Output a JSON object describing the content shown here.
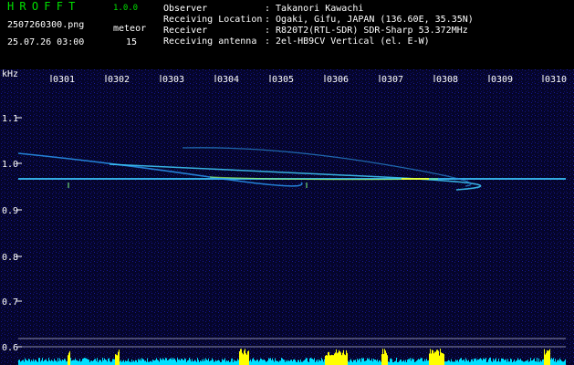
{
  "app": {
    "title": "HROFFT",
    "version": "1.0.0"
  },
  "file": {
    "name": "2507260300.png",
    "datetime": "25.07.26 03:00"
  },
  "meteor": {
    "label": "meteor",
    "count": "15"
  },
  "info": [
    {
      "label": "Observer",
      "value": ": Takanori Kawachi"
    },
    {
      "label": "Receiving Location",
      "value": ": Ogaki, Gifu, JAPAN (136.60E, 35.35N)"
    },
    {
      "label": "Receiver",
      "value": ": R820T2(RTL-SDR) SDR-Sharp 53.372MHz"
    },
    {
      "label": "Receiving antenna",
      "value": ": 2el-HB9CV Vertical (el. E-W)"
    }
  ],
  "waterfall": {
    "unit": "kHz",
    "time_labels": [
      "0301",
      "0302",
      "0303",
      "0304",
      "0305",
      "0306",
      "0307",
      "0308",
      "0309",
      "0310"
    ],
    "freq_labels": [
      "1.1",
      "1.0",
      "0.9",
      "0.8",
      "0.7",
      "0.6"
    ],
    "colors": {
      "background": "#05052a",
      "carrier": "#3cc8ff",
      "baseline": "#00e0ff",
      "peak": "#ffff00"
    }
  }
}
